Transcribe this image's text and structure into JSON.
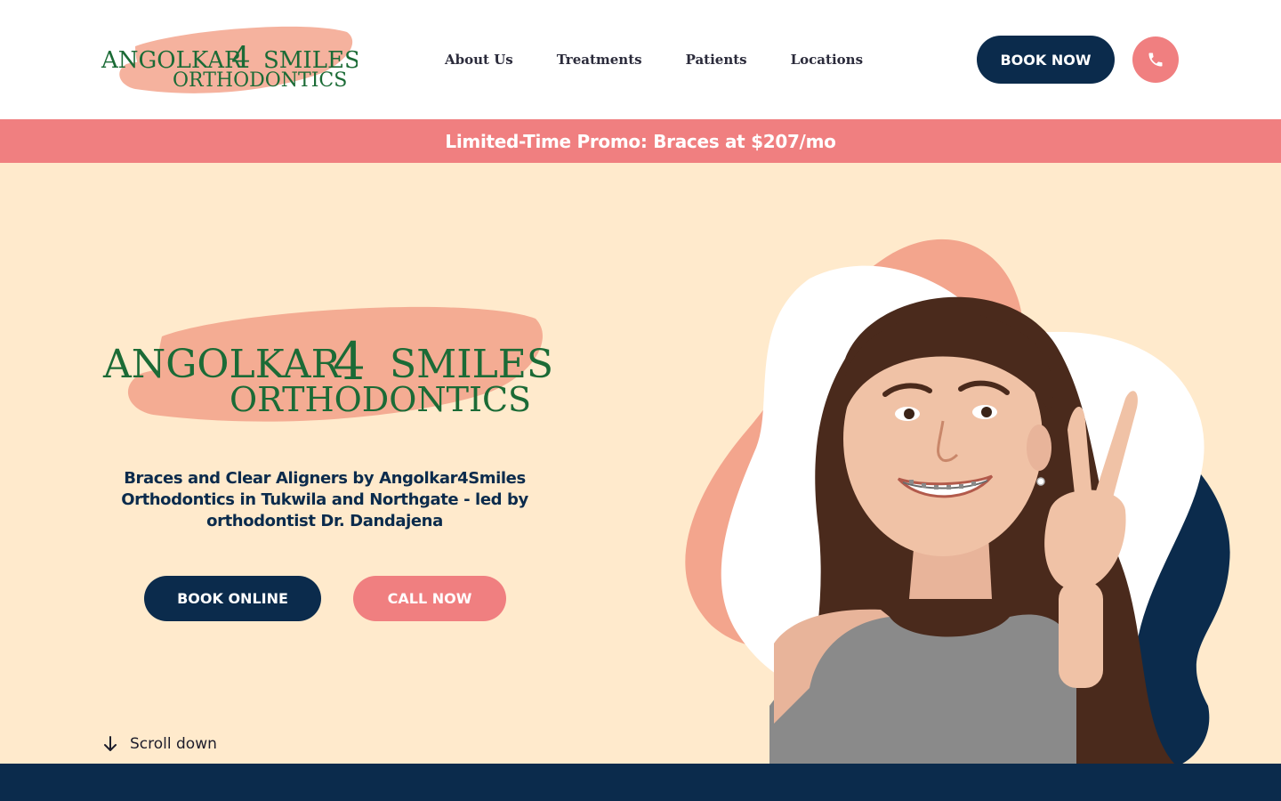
{
  "brand": {
    "logo_line1": "ANGOLKAR",
    "logo_numeral": "4",
    "logo_line1b": "SMILES",
    "logo_line2": "ORTHODONTICS"
  },
  "nav": {
    "items": [
      {
        "label": "About Us"
      },
      {
        "label": "Treatments"
      },
      {
        "label": "Patients"
      },
      {
        "label": "Locations"
      }
    ]
  },
  "header": {
    "book_label": "BOOK NOW",
    "phone_icon": "phone-icon"
  },
  "promo": {
    "text": "Limited-Time Promo: Braces at $207/mo"
  },
  "hero": {
    "tagline": "Braces and Clear Aligners by Angolkar4Smiles Orthodontics in Tukwila and Northgate - led by orthodontist Dr. Dandajena",
    "book_online_label": "BOOK ONLINE",
    "call_now_label": "CALL NOW",
    "scroll_label": "Scroll down",
    "scroll_icon": "arrow-down-icon"
  },
  "colors": {
    "navy": "#0b2b4c",
    "coral": "#f07f80",
    "salmon": "#f3a58d",
    "cream": "#ffeacc",
    "logo_green": "#1b6b36"
  }
}
